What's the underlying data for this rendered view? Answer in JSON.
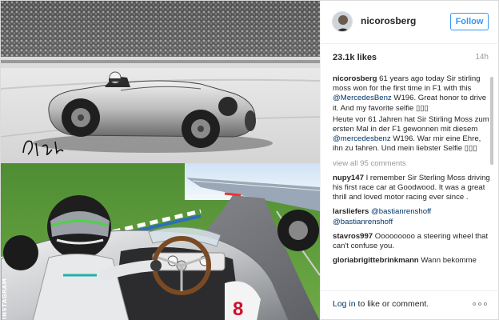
{
  "post": {
    "watermark": "INSTAGRAM",
    "signature": "Stirling Moss"
  },
  "header": {
    "username": "nicorosberg",
    "follow_label": "Follow"
  },
  "stats": {
    "likes": "23.1k likes",
    "time": "14h"
  },
  "caption": {
    "user": "nicorosberg",
    "text_en_1": " 61 years ago today Sir stirling moss won for the first time in F1 with this ",
    "mention_1": "@MercedesBenz",
    "text_en_2": " W196. Great honor to drive it. And my favorite selfie ▯▯▯",
    "text_de_1": "Heute vor 61 Jahren hat Sir Stirling Moss zum ersten Mal in der F1 gewonnen mit diesem ",
    "mention_2": "@mercedesbenz",
    "text_de_2": " W196. War mir eine Ehre, ihn zu fahren. Und mein liebster Selfie ▯▯▯"
  },
  "view_all": "view all 95 comments",
  "comments": [
    {
      "user": "nupy147",
      "text": " I remember Sir Sterling Moss driving his first race car at Goodwood. It was a great thrill and loved motor racing ever since ."
    },
    {
      "user": "larsliefers",
      "mention1": "@bastianrenshoff",
      "mention2": "@bastianrenshoff"
    },
    {
      "user": "stavros997",
      "text": " Ooooooooo a steering wheel that can't confuse you."
    },
    {
      "user": "gloriabrigittebrinkmann",
      "text": " Wann bekomme"
    }
  ],
  "footer": {
    "login_link": "Log in",
    "login_rest": " to like or comment."
  },
  "colors": {
    "accent": "#3897f0",
    "mention": "#003569",
    "muted": "#999999"
  },
  "icons": {
    "more": "more-options-icon"
  }
}
